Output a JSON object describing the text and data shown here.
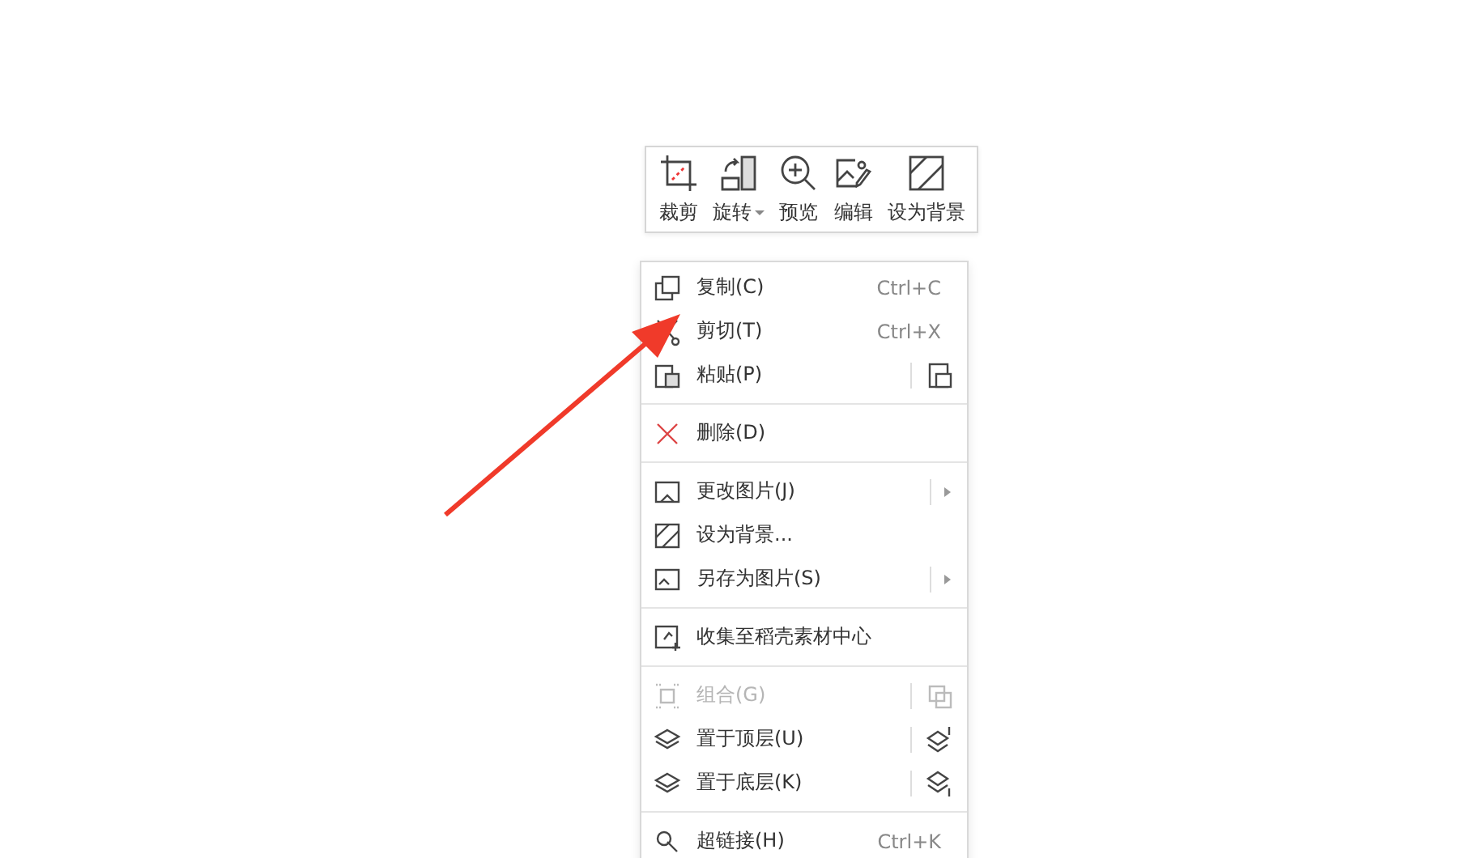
{
  "toolbar": [
    {
      "label": "裁剪",
      "dropdown": false
    },
    {
      "label": "旋转",
      "dropdown": true
    },
    {
      "label": "预览",
      "dropdown": false
    },
    {
      "label": "编辑",
      "dropdown": false
    },
    {
      "label": "设为背景",
      "dropdown": false
    }
  ],
  "menu": [
    [
      {
        "label": "复制(C)",
        "kind": "shortcut",
        "shortcut": "Ctrl+C",
        "disabled": false
      },
      {
        "label": "剪切(T)",
        "kind": "shortcut",
        "shortcut": "Ctrl+X",
        "disabled": false
      },
      {
        "label": "粘贴(P)",
        "kind": "action",
        "disabled": false
      }
    ],
    [
      {
        "label": "删除(D)",
        "kind": "plain",
        "disabled": false
      }
    ],
    [
      {
        "label": "更改图片(J)",
        "kind": "submenu",
        "disabled": false
      },
      {
        "label": "设为背景...",
        "kind": "plain",
        "disabled": false
      },
      {
        "label": "另存为图片(S)",
        "kind": "submenu",
        "disabled": false
      }
    ],
    [
      {
        "label": "收集至稻壳素材中心",
        "kind": "plain",
        "disabled": false
      }
    ],
    [
      {
        "label": "组合(G)",
        "kind": "action",
        "disabled": true
      },
      {
        "label": "置于顶层(U)",
        "kind": "action",
        "disabled": false
      },
      {
        "label": "置于底层(K)",
        "kind": "action",
        "disabled": false
      }
    ],
    [
      {
        "label": "超链接(H)",
        "kind": "shortcut",
        "shortcut": "Ctrl+K",
        "disabled": false
      }
    ]
  ]
}
